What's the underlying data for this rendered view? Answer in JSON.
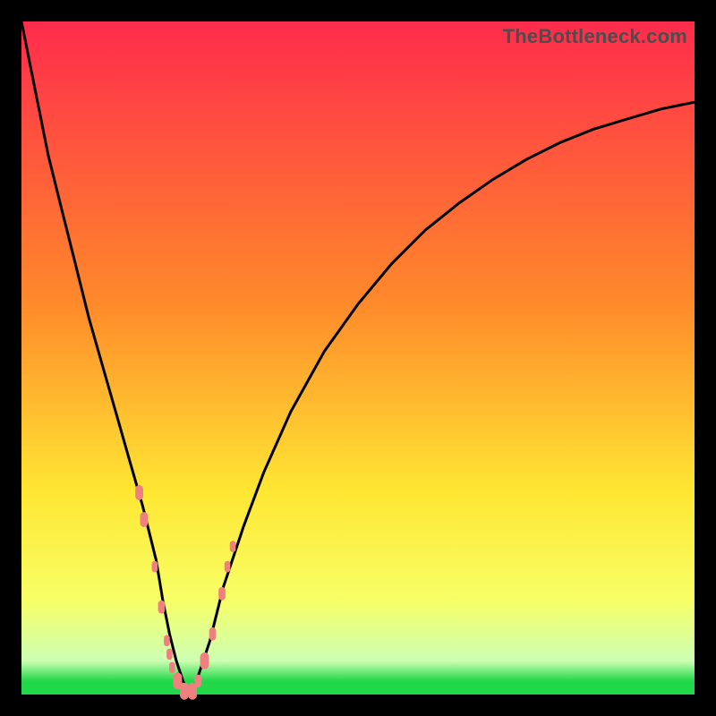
{
  "watermark": "TheBottleneck.com",
  "gradient": {
    "top": "#ff2b4c",
    "mid1": "#ff8a2a",
    "mid2": "#ffe733",
    "low": "#f7ff66",
    "base_light": "#cdffb3",
    "green": "#20d848"
  },
  "chart_data": {
    "type": "line",
    "title": "",
    "xlabel": "",
    "ylabel": "",
    "xlim": [
      0,
      100
    ],
    "ylim": [
      0,
      100
    ],
    "x": [
      0,
      2,
      4,
      6,
      8,
      10,
      12,
      14,
      16,
      18,
      20,
      21,
      22,
      23,
      24,
      25,
      26,
      28,
      30,
      33,
      36,
      40,
      45,
      50,
      55,
      60,
      65,
      70,
      75,
      80,
      85,
      90,
      95,
      100
    ],
    "values": [
      100,
      90,
      80,
      72,
      64,
      56,
      49,
      42,
      35,
      28,
      20,
      14,
      9,
      5,
      2,
      0,
      2,
      8,
      16,
      25,
      33,
      42,
      51,
      58,
      64,
      69,
      73,
      76.5,
      79.5,
      82,
      84,
      85.5,
      87,
      88
    ],
    "beads": {
      "x": [
        17.5,
        18.2,
        19.8,
        20.8,
        21.6,
        22.0,
        22.4,
        23.2,
        24.2,
        25.4,
        26.2,
        27.2,
        28.4,
        29.8,
        30.6,
        31.4
      ],
      "y": [
        30,
        26,
        19,
        13,
        8,
        6,
        4,
        2,
        0.5,
        0.5,
        2,
        5,
        9,
        15,
        19,
        22
      ],
      "r": [
        8,
        8,
        6,
        7,
        6,
        6,
        6,
        9,
        9,
        9,
        7,
        9,
        7,
        7,
        6,
        6
      ]
    }
  }
}
